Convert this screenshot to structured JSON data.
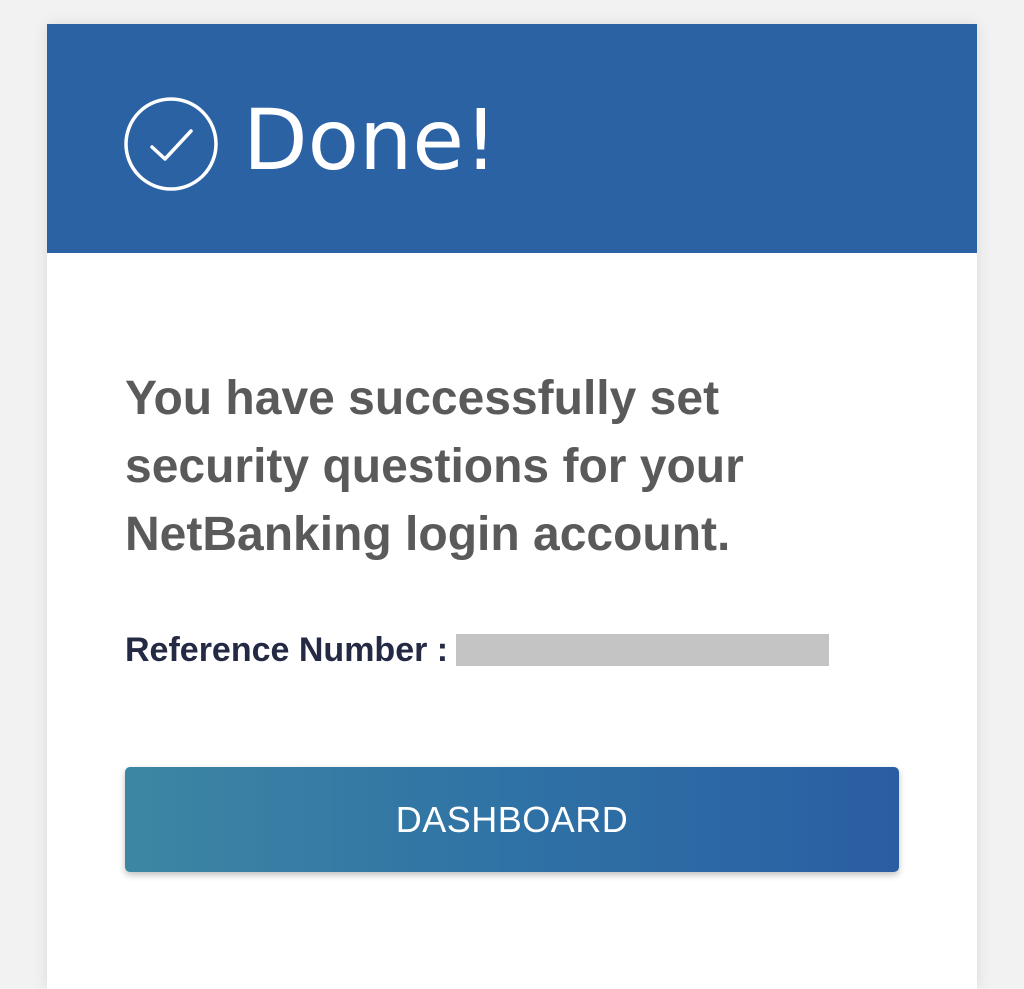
{
  "header": {
    "title": "Done!",
    "icon": "check-circle-icon",
    "background_color": "#2a62a4"
  },
  "body": {
    "message": "You have successfully set security questions for your NetBanking login account.",
    "reference_label": "Reference Number :",
    "reference_value": ""
  },
  "actions": {
    "dashboard_label": "DASHBOARD"
  },
  "colors": {
    "message_text": "#5a5a5a",
    "reference_label_text": "#252a44",
    "button_gradient_start": "#3d86a3",
    "button_gradient_end": "#2a5ea3",
    "redaction": "#c4c4c4"
  }
}
